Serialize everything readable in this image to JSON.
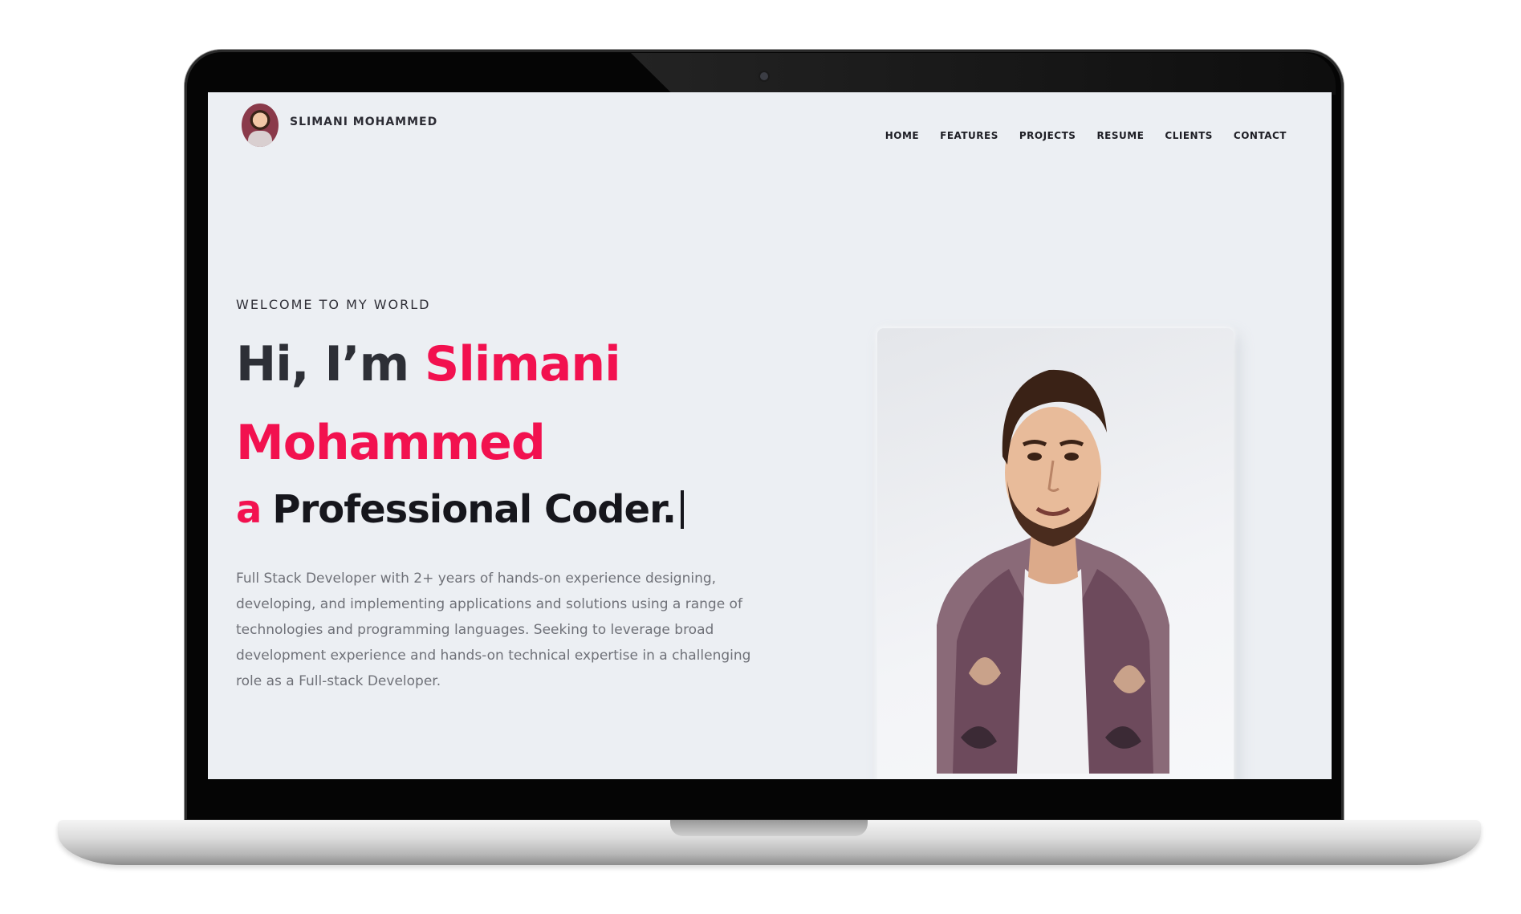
{
  "header": {
    "brand_name": "SLIMANI MOHAMMED",
    "nav": [
      "HOME",
      "FEATURES",
      "PROJECTS",
      "RESUME",
      "CLIENTS",
      "CONTACT"
    ]
  },
  "hero": {
    "welcome": "WELCOME TO MY WORLD",
    "greeting": "Hi, I’m ",
    "first_name": "Slimani",
    "last_name": "Mohammed",
    "role_prefix": "a",
    "role": "Professional Coder.",
    "bio": "Full Stack Developer with 2+ years of hands-on experience designing, developing, and implementing applications and solutions using a range of technologies and programming languages. Seeking to leverage broad development experience and hands-on technical expertise in a challenging role as a Full-stack Developer."
  },
  "colors": {
    "accent": "#f2114f",
    "screen_bg": "#eceff3",
    "text_dark": "#2d2f36",
    "text_muted": "#6f7178"
  },
  "icons": {
    "avatar": "profile-avatar",
    "camera": "webcam-dot"
  }
}
